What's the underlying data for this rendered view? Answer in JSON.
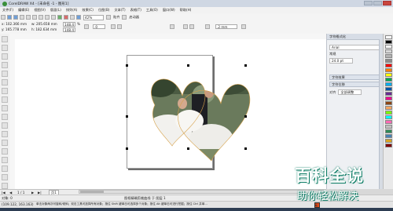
{
  "window": {
    "title": "CorelDRAW X4 - [未命名 -1 - 图形1]"
  },
  "menu": [
    "文件(F)",
    "编辑(E)",
    "视图(V)",
    "版面(L)",
    "排列(A)",
    "效果(C)",
    "位图(B)",
    "文本(T)",
    "表格(T)",
    "工具(O)",
    "窗口(W)",
    "帮助(H)"
  ],
  "toolbar": {
    "zoom": "42%",
    "snap_label": "贴齐",
    "launch_label": "启动器"
  },
  "propbar": {
    "x": "x: 102.366 mm",
    "y": "y: 165.778 mm",
    "width": "w: 205.658 mm",
    "height": "h: 182.634 mm",
    "scale_w": "148.4",
    "scale_h": "148.4",
    "pct": "%",
    "angle": ".0",
    "outline": ".2 mm"
  },
  "docker": {
    "title": "字符格式化",
    "font": "Arial",
    "style_label": "常规",
    "size": "24.0 pt",
    "section_char": "字符效果",
    "section_para": "字符位移",
    "align_label": "对齐",
    "align_value": "全部调整"
  },
  "pages": {
    "indicator": "1 / 1",
    "tab": "页1"
  },
  "status": {
    "line1_left": "对象: 0",
    "line1_center": "图框精确剪裁曲线 于 图层 1",
    "line2_left": "(109.122, 163.163)",
    "line2_center": "单击对象两次可旋转/倾斜；双击工具可选择所有对象；按住 Shift 键单击可选择多个对象；按住 Alt 键单击可进行挖掘；按住 Ctrl 并单...",
    "line2_right": "无"
  },
  "watermark": {
    "brand": "百科全说",
    "slogan": "助你轻松解决"
  },
  "colors": {
    "palette": [
      "#ffffff",
      "#000000",
      "#f5f5f5",
      "#d8d8d8",
      "#b2b2b2",
      "#8c8c8c",
      "#ff0000",
      "#ff7f00",
      "#ffff00",
      "#00a651",
      "#00aeef",
      "#0054a6",
      "#662d91",
      "#ec008c",
      "#8b4513",
      "#f4a460",
      "#7fff00",
      "#00ffff",
      "#ff69b4",
      "#c0c0c0",
      "#2e8b57",
      "#4682b4",
      "#daa520",
      "#800000"
    ],
    "brand_green": "#0a7b63"
  }
}
